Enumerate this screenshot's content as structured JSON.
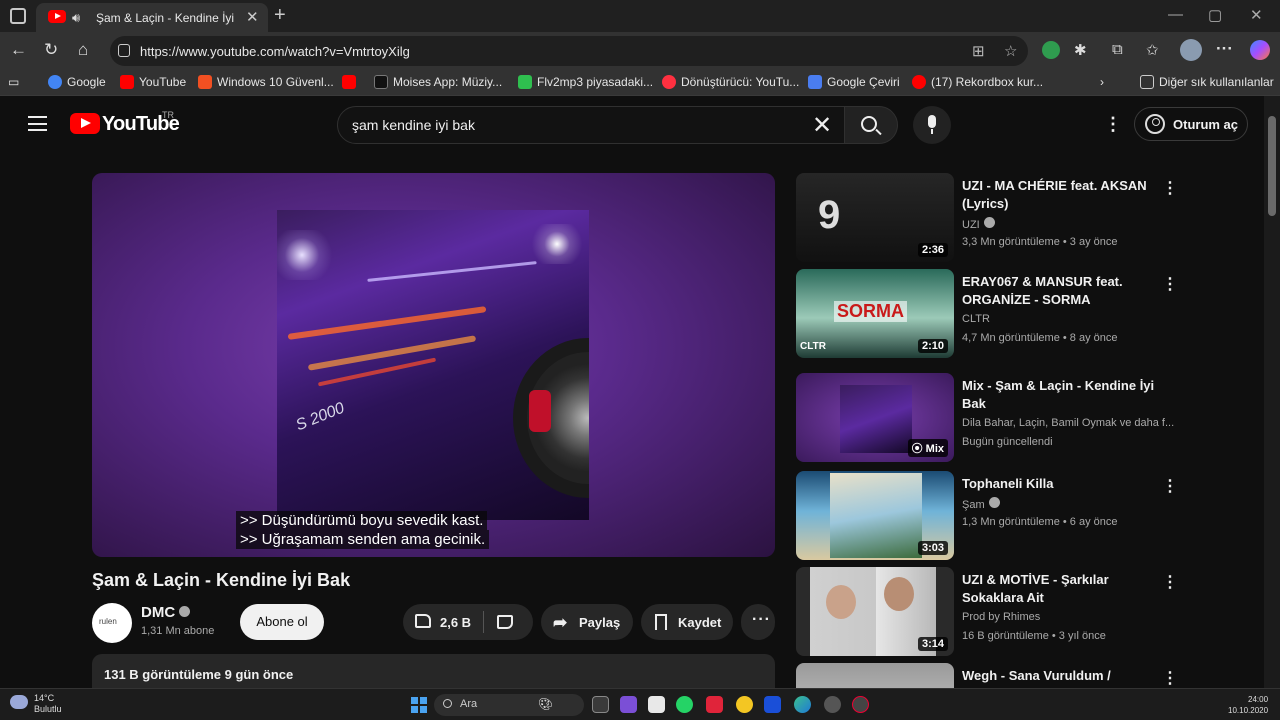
{
  "browser": {
    "tab_title": "Şam & Laçin - Kendine İyi B",
    "url": "https://www.youtube.com/watch?v=VmtrtoyXilg",
    "bookmarks": [
      "Google",
      "YouTube",
      "Windows 10 Güvenl...",
      "",
      "Moises App: Müziy...",
      "Flv2mp3 piyasadaki...",
      "Dönüştürücü: YouTu...",
      "Google Çeviri",
      "(17) Rekordbox kur..."
    ],
    "bookmarks_other": "Diğer sık kullanılanlar",
    "bookmark_colors": [
      "#4285f4",
      "#ff0000",
      "#f25022",
      "#ff0000",
      "#111111",
      "#2fbf4f",
      "#ff3040",
      "#4a7df0",
      "#ff0000"
    ]
  },
  "youtube": {
    "logo_text": "YouTube",
    "logo_region": "TR",
    "search_query": "şam kendine iyi bak",
    "sign_in": "Oturum aç"
  },
  "video": {
    "captions": [
      ">> Düşündürümü boyu sevedik kast.",
      ">> Uğraşamam senden ama gecinik."
    ],
    "title": "Şam & Laçin - Kendine İyi Bak",
    "channel": "DMC",
    "channel_avatar_text": "rulen",
    "subscribers": "1,31 Mn abone",
    "subscribe_label": "Abone ol",
    "likes": "2,6 B",
    "share_label": "Paylaş",
    "save_label": "Kaydet",
    "description_meta": "131 B görüntüleme  9 gün önce"
  },
  "recommendations": [
    {
      "title": "UZI - MA CHÉRIE feat. AKSAN (Lyrics)",
      "channel": "UZI",
      "verified": true,
      "meta": "3,3 Mn görüntüleme • 3 ay önce",
      "duration": "2:36",
      "thumb_label": "9",
      "colors": [
        "#1a1a1a",
        "#3a3a3a"
      ]
    },
    {
      "title": "ERAY067 & MANSUR feat. ORGANİZE - SORMA",
      "channel": "CLTR",
      "verified": false,
      "meta": "4,7 Mn görüntüleme • 8 ay önce",
      "duration": "2:10",
      "thumb_label": "SORMA",
      "thumb_sublabel": "CLTR",
      "colors": [
        "#1e5a4e",
        "#7fb8a4"
      ]
    },
    {
      "title": "Mix - Şam & Laçin - Kendine İyi Bak",
      "channel": "Dila Bahar, Laçin, Bamil Oymak ve daha f...",
      "verified": false,
      "meta": "Bugün güncellendi",
      "duration": "Mix",
      "thumb_label": "",
      "colors": [
        "#5a2a8c",
        "#2b1240"
      ]
    },
    {
      "title": "Tophaneli Killa",
      "channel": "Şam",
      "verified": true,
      "meta": "1,3 Mn görüntüleme • 6 ay önce",
      "duration": "3:03",
      "thumb_label": "",
      "colors": [
        "#1b4b73",
        "#6fb3d8"
      ]
    },
    {
      "title": "UZI & MOTİVE - Şarkılar Sokaklara Ait",
      "channel": "Prod by Rhimes",
      "verified": false,
      "meta": "16 B görüntüleme • 3 yıl önce",
      "duration": "3:14",
      "thumb_label": "",
      "colors": [
        "#cfcfcf",
        "#4a4a4a"
      ]
    },
    {
      "title": "Wegh -  Sana Vuruldum /",
      "channel": "",
      "verified": false,
      "meta": "",
      "duration": "",
      "thumb_label": "",
      "colors": [
        "#9a9a9a",
        "#d8d8d8"
      ]
    }
  ],
  "taskbar": {
    "weather_line1": "14°C",
    "weather_line2": "Bulutlu",
    "search_label": "Ara",
    "time": "24:00",
    "date": "10.10.2020"
  }
}
